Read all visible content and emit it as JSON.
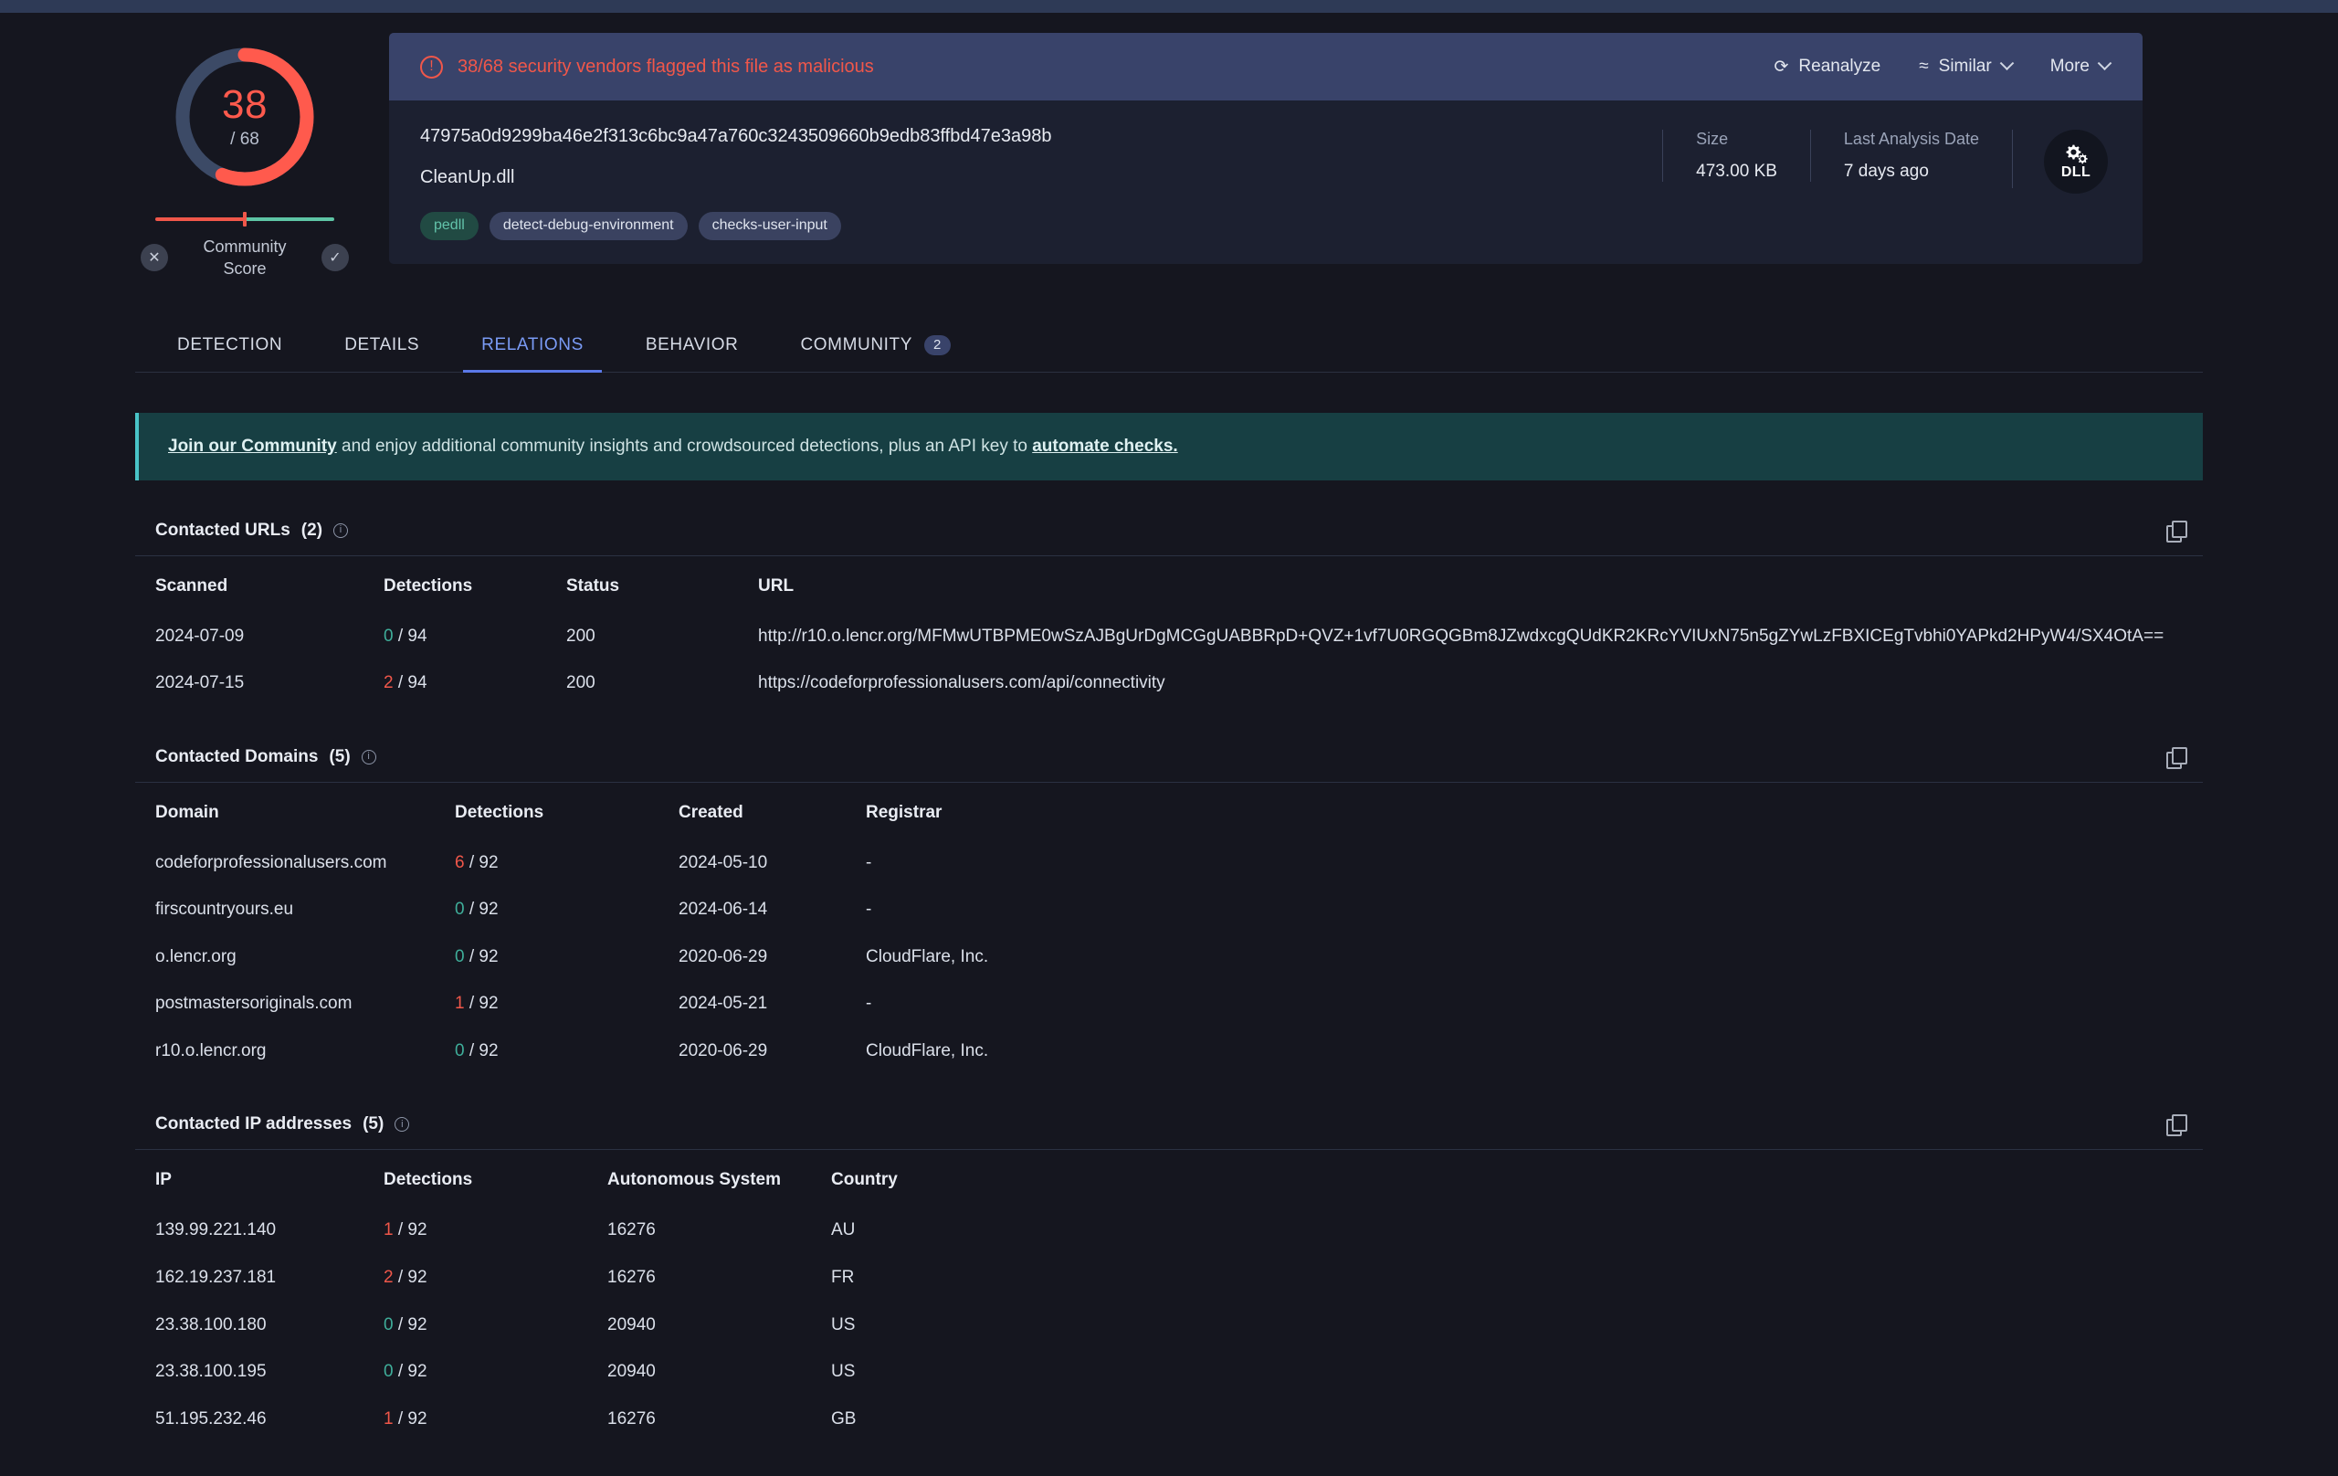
{
  "score": {
    "value": "38",
    "denominator": "/ 68",
    "ratio": 0.5588,
    "community_label": "Community\nScore",
    "vote_down_icon": "✕",
    "vote_up_icon": "✓"
  },
  "alert": {
    "icon": "exclamation-circle-icon",
    "text": "38/68 security vendors flagged this file as malicious",
    "color": "#f0574a",
    "actions": [
      {
        "label": "Reanalyze",
        "icon": "refresh-icon",
        "glyph": "⟳",
        "has_chevron": false
      },
      {
        "label": "Similar",
        "icon": "waves-icon",
        "glyph": "≈",
        "has_chevron": true
      },
      {
        "label": "More",
        "icon": "",
        "glyph": "",
        "has_chevron": true
      }
    ]
  },
  "file": {
    "hash": "47975a0d9299ba46e2f313c6bc9a47a760c3243509660b9edb83ffbd47e3a98b",
    "name": "CleanUp.dll",
    "tags": [
      {
        "label": "pedll",
        "style": "green"
      },
      {
        "label": "detect-debug-environment",
        "style": "blue"
      },
      {
        "label": "checks-user-input",
        "style": "blue"
      }
    ],
    "meta": [
      {
        "label": "Size",
        "value": "473.00 KB"
      },
      {
        "label": "Last Analysis Date",
        "value": "7 days ago"
      }
    ],
    "type_badge": {
      "icon": "gears-icon",
      "label": "DLL"
    }
  },
  "tabs": [
    {
      "label": "DETECTION",
      "active": false,
      "badge": ""
    },
    {
      "label": "DETAILS",
      "active": false,
      "badge": ""
    },
    {
      "label": "RELATIONS",
      "active": true,
      "badge": ""
    },
    {
      "label": "BEHAVIOR",
      "active": false,
      "badge": ""
    },
    {
      "label": "COMMUNITY",
      "active": false,
      "badge": "2"
    }
  ],
  "notice": {
    "link1": "Join our Community",
    "middle": " and enjoy additional community insights and crowdsourced detections, plus an API key to ",
    "link2": "automate checks."
  },
  "sections": [
    {
      "title": "Contacted URLs",
      "count": "(2)",
      "columns": [
        "Scanned",
        "Detections",
        "Status",
        "URL"
      ],
      "rows": [
        {
          "scanned": "2024-07-09",
          "det_hits": "0",
          "det_total": "/ 94",
          "det_state": "zero",
          "status": "200",
          "url": "http://r10.o.lencr.org/MFMwUTBPME0wSzAJBgUrDgMCGgUABBRpD+QVZ+1vf7U0RGQGBm8JZwdxcgQUdKR2KRcYVIUxN75n5gZYwLzFBXICEgTvbhi0YAPkd2HPyW4/SX4OtA=="
        },
        {
          "scanned": "2024-07-15",
          "det_hits": "2",
          "det_total": "/ 94",
          "det_state": "hit",
          "status": "200",
          "url": "https://codeforprofessionalusers.com/api/connectivity"
        }
      ]
    },
    {
      "title": "Contacted Domains",
      "count": "(5)",
      "columns": [
        "Domain",
        "Detections",
        "Created",
        "Registrar"
      ],
      "rows": [
        {
          "domain": "codeforprofessionalusers.com",
          "det_hits": "6",
          "det_total": "/ 92",
          "det_state": "hit",
          "created": "2024-05-10",
          "registrar": "-"
        },
        {
          "domain": "firscountryours.eu",
          "det_hits": "0",
          "det_total": "/ 92",
          "det_state": "zero",
          "created": "2024-06-14",
          "registrar": "-"
        },
        {
          "domain": "o.lencr.org",
          "det_hits": "0",
          "det_total": "/ 92",
          "det_state": "zero",
          "created": "2020-06-29",
          "registrar": "CloudFlare, Inc."
        },
        {
          "domain": "postmastersoriginals.com",
          "det_hits": "1",
          "det_total": "/ 92",
          "det_state": "hit",
          "created": "2024-05-21",
          "registrar": "-"
        },
        {
          "domain": "r10.o.lencr.org",
          "det_hits": "0",
          "det_total": "/ 92",
          "det_state": "zero",
          "created": "2020-06-29",
          "registrar": "CloudFlare, Inc."
        }
      ]
    },
    {
      "title": "Contacted IP addresses",
      "count": "(5)",
      "columns": [
        "IP",
        "Detections",
        "Autonomous System",
        "Country"
      ],
      "rows": [
        {
          "ip": "139.99.221.140",
          "det_hits": "1",
          "det_total": "/ 92",
          "det_state": "hit",
          "asn": "16276",
          "country": "AU"
        },
        {
          "ip": "162.19.237.181",
          "det_hits": "2",
          "det_total": "/ 92",
          "det_state": "hit",
          "asn": "16276",
          "country": "FR"
        },
        {
          "ip": "23.38.100.180",
          "det_hits": "0",
          "det_total": "/ 92",
          "det_state": "zero",
          "asn": "20940",
          "country": "US"
        },
        {
          "ip": "23.38.100.195",
          "det_hits": "0",
          "det_total": "/ 92",
          "det_state": "zero",
          "asn": "20940",
          "country": "US"
        },
        {
          "ip": "51.195.232.46",
          "det_hits": "1",
          "det_total": "/ 92",
          "det_state": "hit",
          "asn": "16276",
          "country": "GB"
        }
      ]
    }
  ],
  "colors": {
    "malicious": "#f0574a",
    "clean": "#3fae9a",
    "accent": "#5b79e8",
    "notice_bg": "#173f43",
    "donut_track": "#3c4a66"
  }
}
